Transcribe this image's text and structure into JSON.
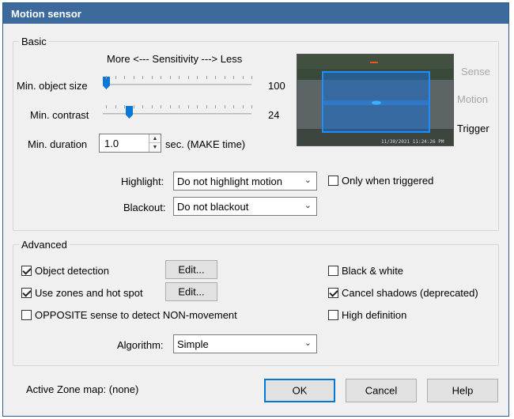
{
  "window": {
    "title": "Motion sensor"
  },
  "basic": {
    "legend": "Basic",
    "sensitivity_caption": "More <--- Sensitivity ---> Less",
    "min_object_size": {
      "label": "Min. object size",
      "value": "100",
      "level": 0
    },
    "min_contrast": {
      "label": "Min. contrast",
      "value": "24",
      "level": 0.16
    },
    "min_duration": {
      "label": "Min. duration",
      "value": "1.0",
      "suffix": "sec.  (MAKE time)"
    },
    "preview": {
      "timestamp": "11/30/2021  11:24:26 PM"
    },
    "indicators": {
      "sense": "Sense",
      "motion": "Motion",
      "trigger": "Trigger"
    },
    "highlight": {
      "label": "Highlight:",
      "value": "Do not highlight motion"
    },
    "only_when_triggered": {
      "label": "Only when triggered",
      "checked": false
    },
    "blackout": {
      "label": "Blackout:",
      "value": "Do not blackout"
    }
  },
  "advanced": {
    "legend": "Advanced",
    "object_detection": {
      "label": "Object detection",
      "checked": true,
      "edit_label": "Edit..."
    },
    "use_zones": {
      "label": "Use zones and hot spot",
      "checked": true,
      "edit_label": "Edit..."
    },
    "opposite_sense": {
      "label": "OPPOSITE sense to detect NON-movement",
      "checked": false
    },
    "black_white": {
      "label": "Black & white",
      "checked": false
    },
    "cancel_shadows": {
      "label": "Cancel shadows (deprecated)",
      "checked": true
    },
    "high_definition": {
      "label": "High definition",
      "checked": false
    },
    "algorithm": {
      "label": "Algorithm:",
      "value": "Simple"
    }
  },
  "footer": {
    "active_zone_map": "Active Zone map:  (none)",
    "ok": "OK",
    "cancel": "Cancel",
    "help": "Help"
  },
  "colors": {
    "accent": "#0078d7",
    "title_bar": "#3c6a9c",
    "slider_thumb": "#0a78d7"
  }
}
